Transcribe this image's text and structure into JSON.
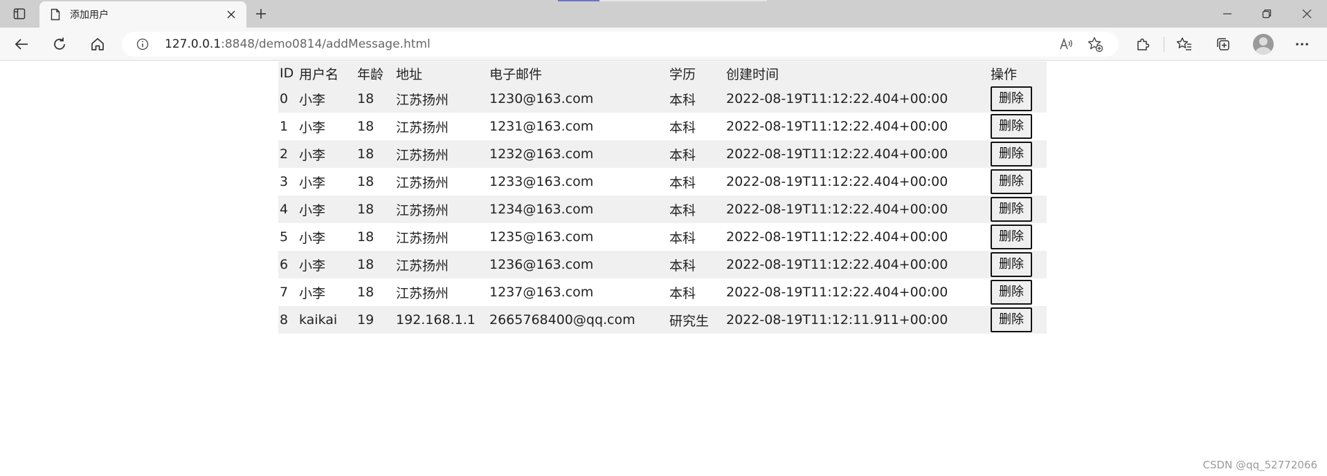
{
  "browser": {
    "tab_title": "添加用户",
    "url_host": "127.0.0.1",
    "url_rest": ":8848/demo0814/addMessage.html"
  },
  "table": {
    "headers": [
      "ID",
      "用户名",
      "年龄",
      "地址",
      "电子邮件",
      "学历",
      "创建时间",
      "操作"
    ],
    "rows": [
      {
        "id": "0",
        "name": "小李",
        "age": "18",
        "address": "江苏扬州",
        "email": "1230@163.com",
        "education": "本科",
        "created": "2022-08-19T11:12:22.404+00:00",
        "action": "删除"
      },
      {
        "id": "1",
        "name": "小李",
        "age": "18",
        "address": "江苏扬州",
        "email": "1231@163.com",
        "education": "本科",
        "created": "2022-08-19T11:12:22.404+00:00",
        "action": "删除"
      },
      {
        "id": "2",
        "name": "小李",
        "age": "18",
        "address": "江苏扬州",
        "email": "1232@163.com",
        "education": "本科",
        "created": "2022-08-19T11:12:22.404+00:00",
        "action": "删除"
      },
      {
        "id": "3",
        "name": "小李",
        "age": "18",
        "address": "江苏扬州",
        "email": "1233@163.com",
        "education": "本科",
        "created": "2022-08-19T11:12:22.404+00:00",
        "action": "删除"
      },
      {
        "id": "4",
        "name": "小李",
        "age": "18",
        "address": "江苏扬州",
        "email": "1234@163.com",
        "education": "本科",
        "created": "2022-08-19T11:12:22.404+00:00",
        "action": "删除"
      },
      {
        "id": "5",
        "name": "小李",
        "age": "18",
        "address": "江苏扬州",
        "email": "1235@163.com",
        "education": "本科",
        "created": "2022-08-19T11:12:22.404+00:00",
        "action": "删除"
      },
      {
        "id": "6",
        "name": "小李",
        "age": "18",
        "address": "江苏扬州",
        "email": "1236@163.com",
        "education": "本科",
        "created": "2022-08-19T11:12:22.404+00:00",
        "action": "删除"
      },
      {
        "id": "7",
        "name": "小李",
        "age": "18",
        "address": "江苏扬州",
        "email": "1237@163.com",
        "education": "本科",
        "created": "2022-08-19T11:12:22.404+00:00",
        "action": "删除"
      },
      {
        "id": "8",
        "name": "kaikai",
        "age": "19",
        "address": "192.168.1.1",
        "email": "2665768400@qq.com",
        "education": "研究生",
        "created": "2022-08-19T11:12:11.911+00:00",
        "action": "删除"
      }
    ]
  },
  "watermark": "CSDN @qq_52772066",
  "colors": {
    "tab_strip": "#cfcfcf",
    "toolbar": "#f7f7f7",
    "row_stripe": "#f0f0f0",
    "accent_underline": "#6b74c7"
  }
}
